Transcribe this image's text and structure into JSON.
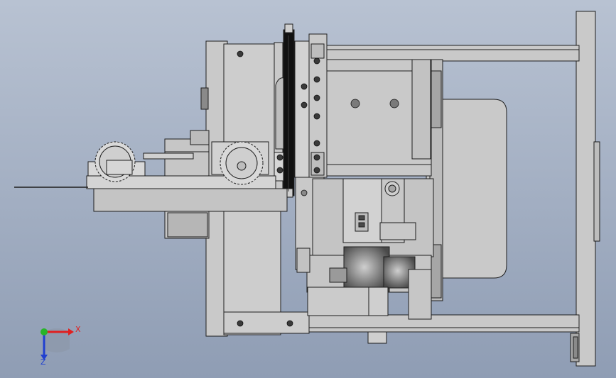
{
  "viewport": {
    "background_top": "#b8c2d2",
    "background_bottom": "#8f9db4"
  },
  "colors": {
    "part_fill": "#c9c9c9",
    "part_fill_light": "#dadada",
    "part_fill_dark": "#9a9a9a",
    "edge": "#1e1e1e",
    "belt": "#111111",
    "x_axis": "#e02020",
    "y_axis": "#28b428",
    "z_axis": "#2040d0"
  },
  "triad": {
    "x_label": "X",
    "z_label": "Z"
  }
}
